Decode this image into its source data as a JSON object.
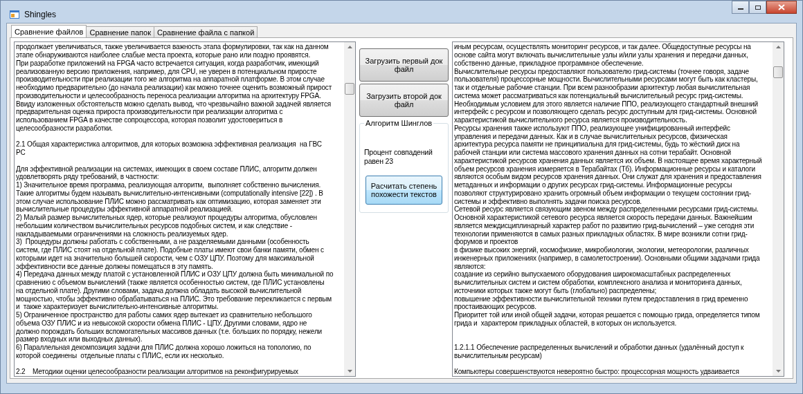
{
  "window": {
    "title": "Shingles"
  },
  "tabs": [
    {
      "label": "Сравнение файлов",
      "selected": true
    },
    {
      "label": "Сравнение папок",
      "selected": false
    },
    {
      "label": "Сравнение файла с папкой",
      "selected": false
    }
  ],
  "left_text": [
    {
      "kind": "text",
      "text": "продолжает увеличиваться, также увеличивается важность этапа формулировки, так как на данном"
    },
    {
      "kind": "text",
      "text": "этапе обнаруживаются наиболее слабые места проекта, которые рано или поздно проявятся."
    },
    {
      "kind": "text",
      "text": "При разработке приложений на FPGA часто встречается ситуация, когда разработчик, имеющий"
    },
    {
      "kind": "text",
      "text": "реализованную версию приложения, например, для CPU, не уверен в потенциальном приросте"
    },
    {
      "kind": "text",
      "text": "производительности при реализации того же алгоритма на аппаратной платформе. В этом случае"
    },
    {
      "kind": "text",
      "text": "необходимо предварительно (до начала реализации) как можно точнее оценить возможный прирост"
    },
    {
      "kind": "text",
      "text": "производительности и целесообразность переноса реализации алгоритма на архитектуру FPGA."
    },
    {
      "kind": "text",
      "text": "Ввиду изложенных обстоятельств можно сделать вывод, что чрезвычайно важной задачей является"
    },
    {
      "kind": "text",
      "text": "предварительная оценка прироста производительности при реализации алгоритма с"
    },
    {
      "kind": "text",
      "text": "использованием FPGA в качестве сопроцессора, которая позволит удостовериться в"
    },
    {
      "kind": "text",
      "text": "целесообразности разработки."
    },
    {
      "kind": "blank"
    },
    {
      "kind": "text",
      "text": "2.1 Общая характеристика алгоритмов, для которых возможна эффективная реализация  на ГВС"
    },
    {
      "kind": "text",
      "text": "РС"
    },
    {
      "kind": "blank"
    },
    {
      "kind": "text",
      "text": "Для эффективной реализации на системах, имеющих в своем составе ПЛИС, алгоритм должен"
    },
    {
      "kind": "text",
      "text": "удовлетворять ряду требований, в частности:"
    },
    {
      "kind": "text",
      "text": "1) Значительное время программа, реализующая алгоритм,  выполняет собственно вычисления."
    },
    {
      "kind": "text",
      "text": "Такие алгоритмы будем называть вычислительно-интенсивными (computationally intensive [22]) . В"
    },
    {
      "kind": "text",
      "text": "этом случае использование ПЛИС можно рассматривать как оптимизацию, которая заменяет эти"
    },
    {
      "kind": "text",
      "text": "вычислительные процедуры эффективной аппаратной реализацией."
    },
    {
      "kind": "text",
      "text": "2) Малый размер вычислительных ядер, которые реализуют процедуры алгоритма, обусловлен"
    },
    {
      "kind": "text",
      "text": "небольшим количеством вычислительных ресурсов подобных систем, и как следствие -"
    },
    {
      "kind": "text",
      "text": "накладываемыми ограничениями на сложность реализуемых ядер."
    },
    {
      "kind": "text",
      "text": "3)  Процедуры должны работать с собственными, а не разделяемыми данными (особенность"
    },
    {
      "kind": "text",
      "text": "систем, где ПЛИС стоят на отдельной плате). Подобные платы имеют свои банки памяти, обмен с"
    },
    {
      "kind": "text",
      "text": "которыми идет на значительно большей скорости, чем с ОЗУ ЦПУ. Поэтому для максимальной"
    },
    {
      "kind": "text",
      "text": "эффективности все данные должны помещаться в эту память."
    },
    {
      "kind": "text",
      "text": "4) Передача данных между платой с установленной ПЛИС и ОЗУ ЦПУ должна быть минимальной по"
    },
    {
      "kind": "text",
      "text": "сравнению с объемом вычислений (также является особенностью систем, где ПЛИС установлены"
    },
    {
      "kind": "text",
      "text": "на отдельной плате). Другими словами, задача должна обладать высокой вычислительной"
    },
    {
      "kind": "text",
      "text": "мощностью, чтобы эффективно обрабатываться на ПЛИС. Это требование перекликается с первым"
    },
    {
      "kind": "text",
      "text": "и  также характеризует вычислительно-интенсивные алгоритмы."
    },
    {
      "kind": "text",
      "text": "5) Ограниченное пространство для работы самих ядер вытекает из сравнительно небольшого"
    },
    {
      "kind": "text",
      "text": "объема ОЗУ ПЛИС и из невысокой скорости обмена ПЛИС - ЦПУ. Другими словами, ядро не"
    },
    {
      "kind": "text",
      "text": "должно порождать больших вспомогательных массивов данных (т.е. больших по порядку, нежели"
    },
    {
      "kind": "text",
      "text": "размер входных или выходных данных)."
    },
    {
      "kind": "text",
      "text": "6) Параллельная декомпозиция задачи для ПЛИС должна хорошо ложиться на топологию, по"
    },
    {
      "kind": "text",
      "text": "которой соединены  отдельные платы с ПЛИС, если их несколько."
    },
    {
      "kind": "blank"
    },
    {
      "kind": "text",
      "text": "2.2    Методики оценки целесообразности реализации алгоритмов на реконфигурируемых"
    }
  ],
  "buttons": {
    "load_first": "Загрузить первый док файл",
    "load_second": "Загрузить второй док файл"
  },
  "algorithm_group": {
    "title": "Алгоритм Шинглов",
    "result": "Процент совпадений равен 23",
    "compute_button": "Расчитать степень похожести текстов"
  },
  "right_text": [
    {
      "kind": "text",
      "text": "иным ресурсам, осуществлять мониторинг ресурсов, и так далее. Общедоступные ресурсы на"
    },
    {
      "kind": "text",
      "text": "основе сайта могут включать вычислительные узлы и/или узлы хранения и передачи данных,"
    },
    {
      "kind": "text",
      "text": "собственно данные, прикладное программное обеспечение."
    },
    {
      "kind": "text",
      "text": "Вычислительные ресурсы предоставляют пользователю грид-системы (точнее говоря, задаче"
    },
    {
      "kind": "text",
      "text": "пользователя) процессорные мощности. Вычислительными ресурсами могут быть как кластеры,"
    },
    {
      "kind": "text",
      "text": "так и отдельные рабочие станции. При всем разнообразии архитектур любая вычислительная"
    },
    {
      "kind": "text",
      "text": "система может рассматриваться как потенциальный вычислительный ресурс грид-системы."
    },
    {
      "kind": "text",
      "text": "Необходимым условием для этого является наличие ППО, реализующего стандартный внешний"
    },
    {
      "kind": "text",
      "text": "интерфейс с ресурсом и позволяющего сделать ресурс доступным для грид-системы. Основной"
    },
    {
      "kind": "text",
      "text": "характеристикой вычислительного ресурса является производительность."
    },
    {
      "kind": "text",
      "text": "Ресурсы хранения также используют ППО, реализующее унифицированный интерфейс"
    },
    {
      "kind": "text",
      "text": "управления и передачи данных. Как и в случае вычислительных ресурсов, физическая"
    },
    {
      "kind": "text",
      "text": "архитектура ресурса памяти не принципиальна для грид-системы, будь то жёсткий диск на"
    },
    {
      "kind": "text",
      "text": "рабочей станции или система массового хранения данных на сотни терабайт. Основной"
    },
    {
      "kind": "text",
      "text": "характеристикой ресурсов хранения данных является их объем. В настоящее время характерный"
    },
    {
      "kind": "text",
      "text": "объем ресурсов хранения измеряется в Терабайтах (Тб). Информационные ресурсы и каталоги"
    },
    {
      "kind": "text",
      "text": "являются особым видом ресурсов хранения данных. Они служат для хранения и предоставления"
    },
    {
      "kind": "text",
      "text": "метаданных и информации о других ресурсах грид-системы. Информационные ресурсы"
    },
    {
      "kind": "text",
      "text": "позволяют структурировано хранить огромный объем информации о текущем состоянии грид-"
    },
    {
      "kind": "text",
      "text": "системы и эффективно выполнять задачи поиска ресурсов."
    },
    {
      "kind": "text",
      "text": "Сетевой ресурс является связующим звеном между распределенными ресурсами грид-системы."
    },
    {
      "kind": "text",
      "text": "Основной характеристикой сетевого ресурса является скорость передачи данных. Важнейшим"
    },
    {
      "kind": "text",
      "text": "является междисциплинарный характер работ по развитию грид-вычислений – уже сегодня эти"
    },
    {
      "kind": "text",
      "text": "технологии применяются в самых разных прикладных областях. В мире возникли сотни грид-"
    },
    {
      "kind": "text",
      "text": "форумов и проектов"
    },
    {
      "kind": "text",
      "text": "в физике высоких энергий, космофизике, микробиологии, экологии, метеорологии, различных"
    },
    {
      "kind": "text",
      "text": "инженерных приложениях (например, в самолетостроении). Основными общими задачами грида"
    },
    {
      "kind": "text",
      "text": "являются:"
    },
    {
      "kind": "text",
      "text": "создание из серийно выпускаемого оборудования широкомасштабных распределенных"
    },
    {
      "kind": "text",
      "text": "вычислительных систем и систем обработки, комплексного анализа и мониторинга данных,"
    },
    {
      "kind": "text",
      "text": "источники которых также могут быть (глобально) распределены;"
    },
    {
      "kind": "text",
      "text": "повышение эффективности вычислительной техники путем предоставления в грид временно"
    },
    {
      "kind": "text",
      "text": "простаивающих ресурсов."
    },
    {
      "kind": "text",
      "text": "Приоритет той или иной общей задачи, которая решается с помощью грида, определяется типом"
    },
    {
      "kind": "text",
      "text": "грида и  характером прикладных областей, в которых он используется."
    },
    {
      "kind": "blank"
    },
    {
      "kind": "blank"
    },
    {
      "kind": "text",
      "text": "1.2.1.1 Обеспечение распределенных вычислений и обработки данных (удалённый доступ к"
    },
    {
      "kind": "text",
      "text": "вычислительным ресурсам)"
    },
    {
      "kind": "blank"
    },
    {
      "kind": "text",
      "text": "Компьютеры совершенствуются невероятно быстро: процессорная мощность удваивается"
    }
  ]
}
